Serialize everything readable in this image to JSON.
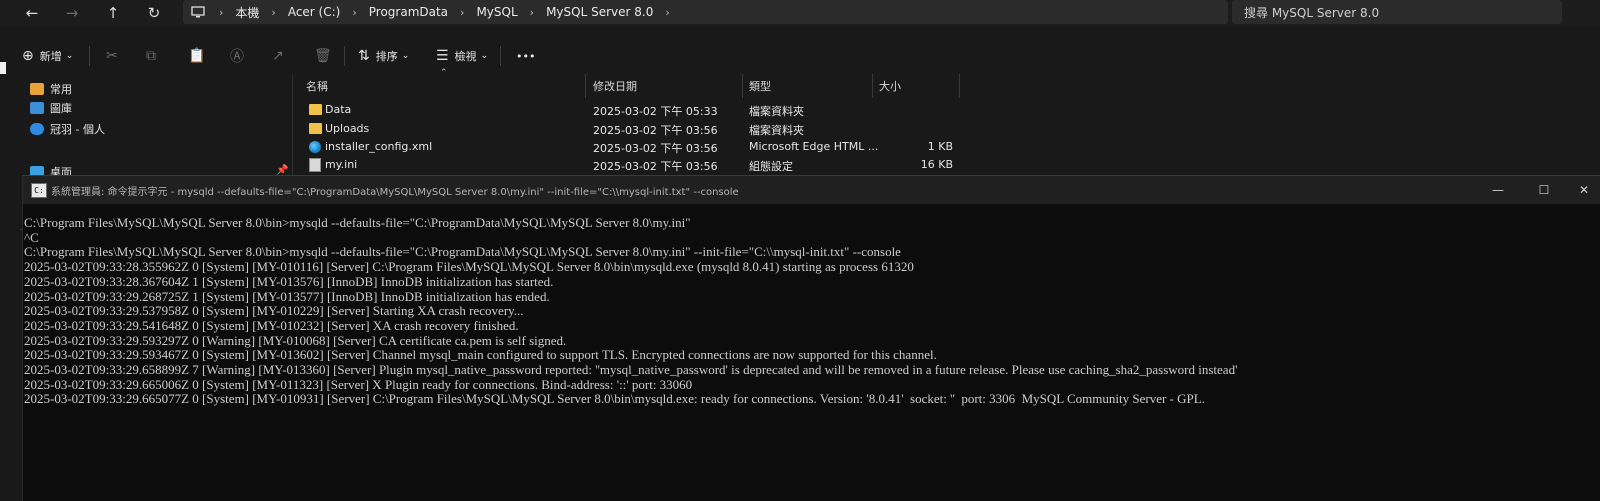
{
  "explorer": {
    "nav": {
      "back_icon": "arrow-left-icon",
      "forward_icon": "arrow-right-icon",
      "up_icon": "arrow-up-icon",
      "refresh_icon": "refresh-icon"
    },
    "breadcrumbs": [
      "本機",
      "Acer (C:)",
      "ProgramData",
      "MySQL",
      "MySQL Server 8.0"
    ],
    "search_placeholder": "搜尋 MySQL Server 8.0",
    "toolbar": {
      "new_label": "新增",
      "sort_label": "排序",
      "view_label": "檢視",
      "more_label": "•••"
    },
    "navpane": [
      {
        "label": "常用",
        "icon": "home-icon"
      },
      {
        "label": "圖庫",
        "icon": "gallery-icon"
      },
      {
        "label": "冠羽 - 個人",
        "icon": "onedrive-icon"
      },
      {
        "label": "桌面",
        "icon": "desktop-icon"
      }
    ],
    "columns": [
      "名稱",
      "修改日期",
      "類型",
      "大小"
    ],
    "files": [
      {
        "name": "Data",
        "date": "2025-03-02 下午 05:33",
        "type": "檔案資料夾",
        "size": "",
        "icon": "folder-icon"
      },
      {
        "name": "Uploads",
        "date": "2025-03-02 下午 03:56",
        "type": "檔案資料夾",
        "size": "",
        "icon": "folder-icon"
      },
      {
        "name": "installer_config.xml",
        "date": "2025-03-02 下午 03:56",
        "type": "Microsoft Edge HTML ...",
        "size": "1 KB",
        "icon": "edge-icon"
      },
      {
        "name": "my.ini",
        "date": "2025-03-02 下午 03:56",
        "type": "組態設定",
        "size": "16 KB",
        "icon": "ini-file-icon"
      }
    ]
  },
  "console": {
    "title": "系統管理員: 命令提示字元 - mysqld  --defaults-file=\"C:\\ProgramData\\MySQL\\MySQL Server 8.0\\my.ini\" --init-file=\"C:\\\\mysql-init.txt\" --console",
    "controls": {
      "minimize": "—",
      "maximize": "☐",
      "close": "✕"
    },
    "lines": [
      "C:\\Program Files\\MySQL\\MySQL Server 8.0\\bin>mysqld --defaults-file=\"C:\\ProgramData\\MySQL\\MySQL Server 8.0\\my.ini\"",
      "^C",
      "C:\\Program Files\\MySQL\\MySQL Server 8.0\\bin>mysqld --defaults-file=\"C:\\ProgramData\\MySQL\\MySQL Server 8.0\\my.ini\" --init-file=\"C:\\\\mysql-init.txt\" --console",
      "2025-03-02T09:33:28.355962Z 0 [System] [MY-010116] [Server] C:\\Program Files\\MySQL\\MySQL Server 8.0\\bin\\mysqld.exe (mysqld 8.0.41) starting as process 61320",
      "2025-03-02T09:33:28.367604Z 1 [System] [MY-013576] [InnoDB] InnoDB initialization has started.",
      "2025-03-02T09:33:29.268725Z 1 [System] [MY-013577] [InnoDB] InnoDB initialization has ended.",
      "2025-03-02T09:33:29.537958Z 0 [System] [MY-010229] [Server] Starting XA crash recovery...",
      "2025-03-02T09:33:29.541648Z 0 [System] [MY-010232] [Server] XA crash recovery finished.",
      "2025-03-02T09:33:29.593297Z 0 [Warning] [MY-010068] [Server] CA certificate ca.pem is self signed.",
      "2025-03-02T09:33:29.593467Z 0 [System] [MY-013602] [Server] Channel mysql_main configured to support TLS. Encrypted connections are now supported for this channel.",
      "2025-03-02T09:33:29.658899Z 7 [Warning] [MY-013360] [Server] Plugin mysql_native_password reported: ''mysql_native_password' is deprecated and will be removed in a future release. Please use caching_sha2_password instead'",
      "2025-03-02T09:33:29.665006Z 0 [System] [MY-011323] [Server] X Plugin ready for connections. Bind-address: '::' port: 33060",
      "2025-03-02T09:33:29.665077Z 0 [System] [MY-010931] [Server] C:\\Program Files\\MySQL\\MySQL Server 8.0\\bin\\mysqld.exe: ready for connections. Version: '8.0.41'  socket: ''  port: 3306  MySQL Community Server - GPL."
    ]
  }
}
